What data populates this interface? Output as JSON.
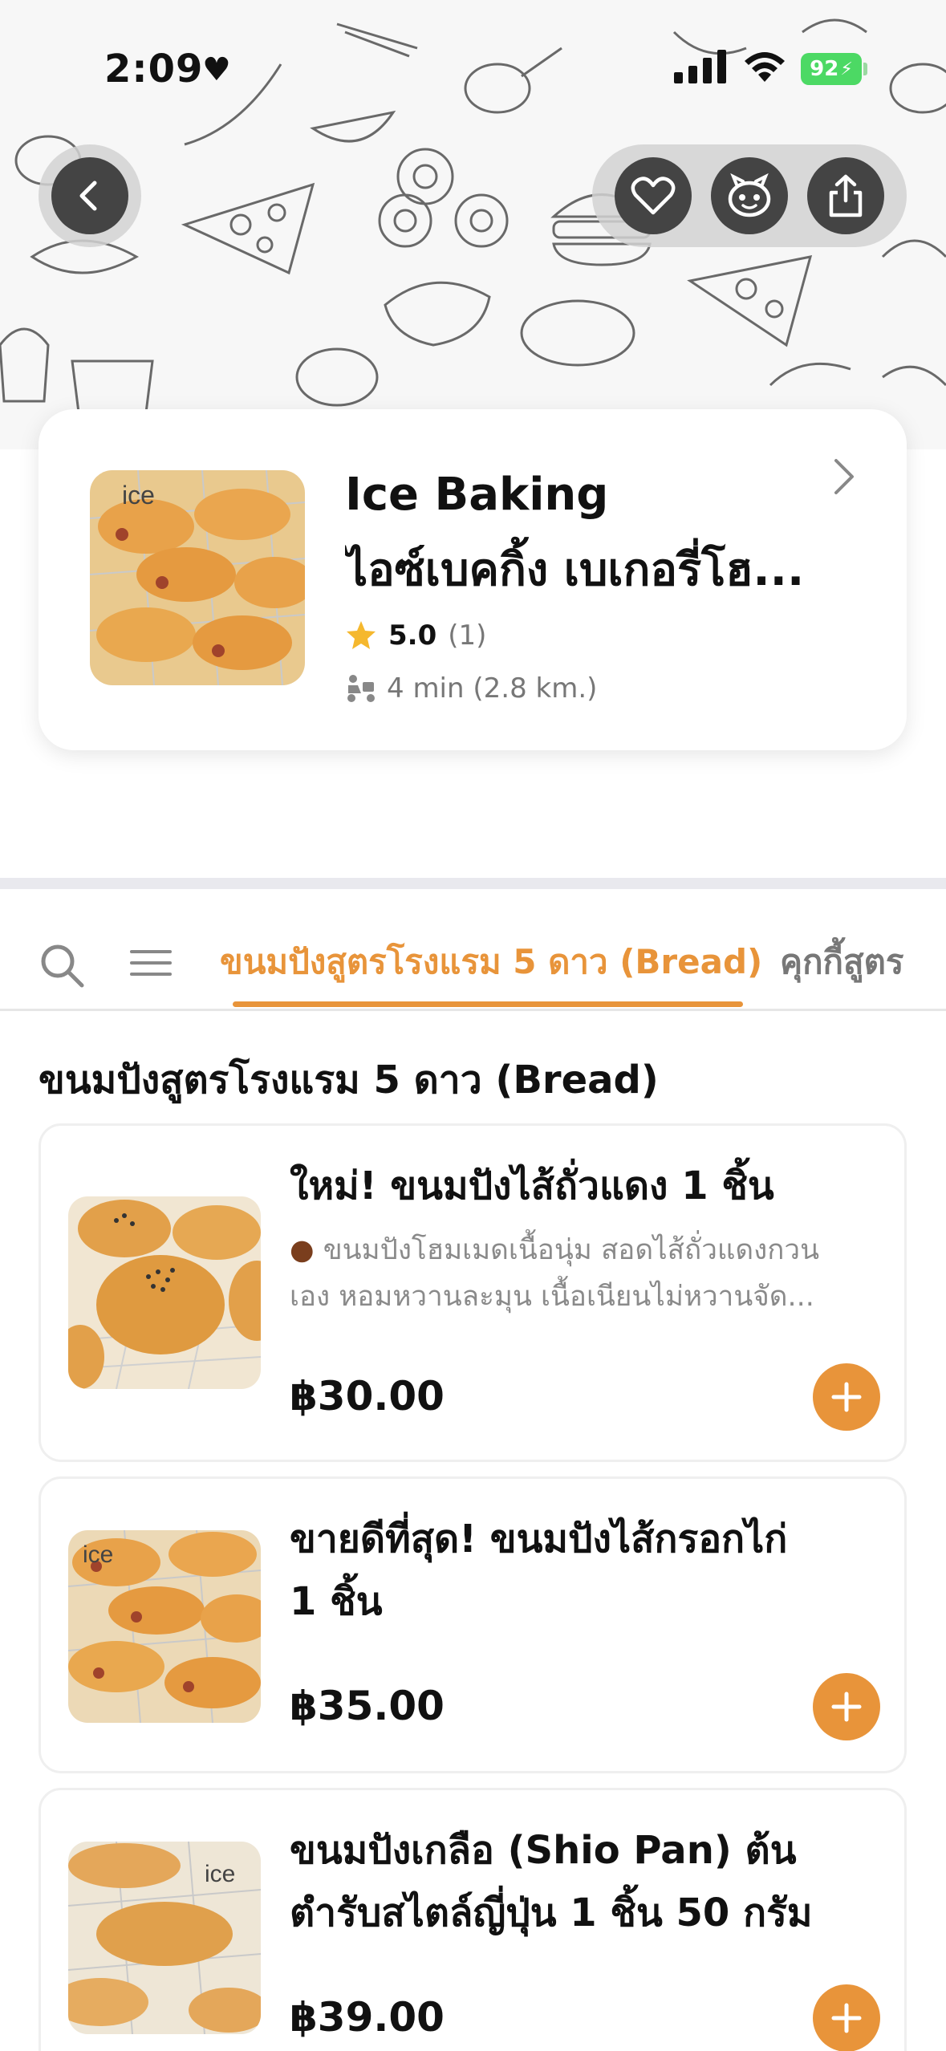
{
  "status_bar": {
    "time": "2:09",
    "battery": "92"
  },
  "store": {
    "name_line1": "Ice Baking",
    "name_line2": "ไอซ์เบคกิ้ง เบเกอรี่โฮ...",
    "rating": "5.0",
    "rating_count": "(1)",
    "eta": "4 min (2.8 km.)"
  },
  "tabs": {
    "active": "ขนมปังสูตรโรงแรม 5 ดาว (Bread)",
    "next": "คุกกี้สูตร"
  },
  "section": {
    "title": "ขนมปังสูตรโรงแรม 5 ดาว (Bread)"
  },
  "items": [
    {
      "name": "ใหม่! ขนมปังไส้ถั่วแดง 1 ชิ้น",
      "desc_line1": "ขนมปังโฮมเมดเนื้อนุ่ม สอดไส้ถั่วแดงกวน",
      "desc_line2": "เอง หอมหวานละมุน เนื้อเนียนไม่หวานจัด...",
      "price": "฿30.00"
    },
    {
      "name_line1": "ขายดีที่สุด! ขนมปังไส้กรอกไก่",
      "name_line2": "1 ชิ้น",
      "price": "฿35.00"
    },
    {
      "name_line1": "ขนมปังเกลือ (Shio Pan) ต้น",
      "name_line2": "ตำรับสไตล์ญี่ปุ่น 1 ชิ้น 50 กรัม",
      "price": "฿39.00"
    }
  ],
  "colors": {
    "accent": "#e8943a",
    "star": "#f5b82e",
    "battery": "#4cd964"
  },
  "icons": [
    "back-arrow-icon",
    "heart-icon",
    "mascot-icon",
    "share-icon",
    "chevron-right-icon",
    "star-icon",
    "rider-icon",
    "search-icon",
    "menu-icon",
    "plus-icon"
  ]
}
